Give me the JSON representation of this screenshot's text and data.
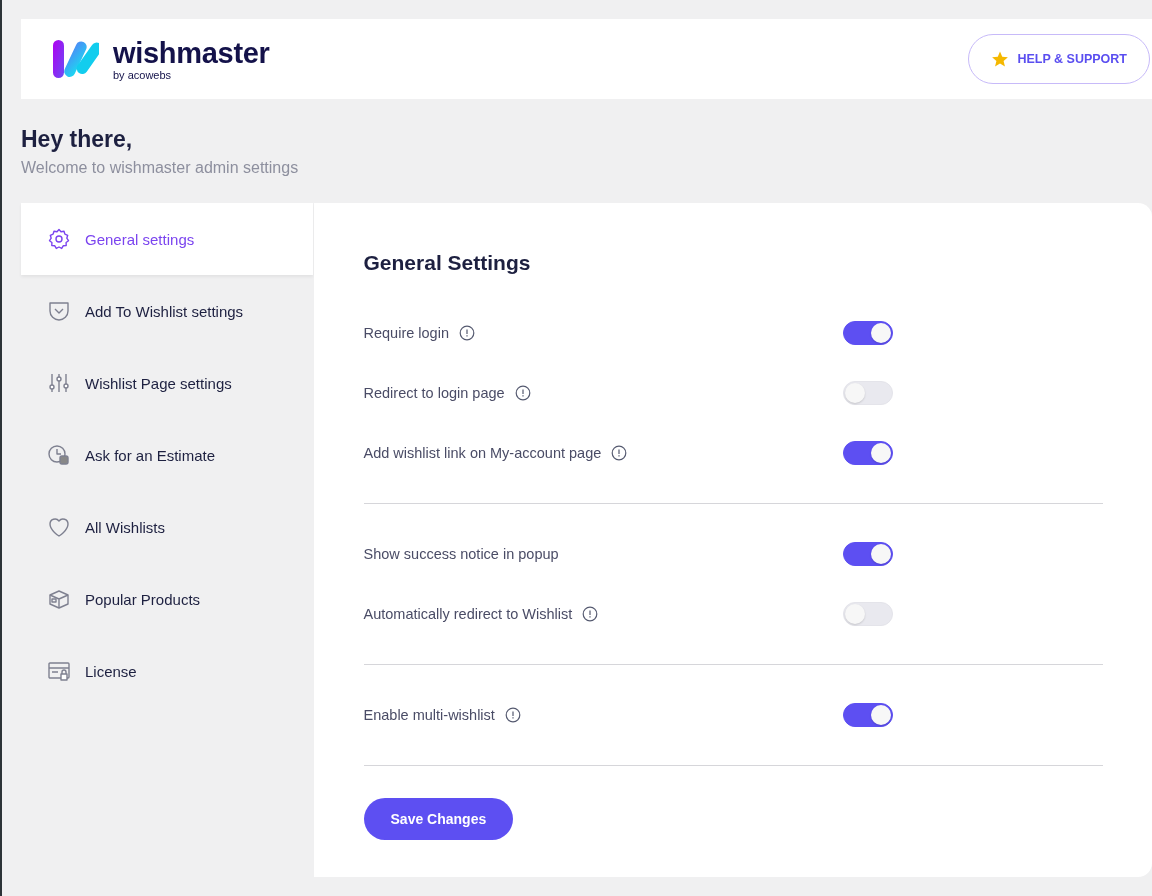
{
  "header": {
    "brand": "wishmaster",
    "byline": "by acowebs",
    "help_button": "HELP & SUPPORT"
  },
  "greeting": {
    "title": "Hey there,",
    "subtitle": "Welcome to wishmaster admin settings"
  },
  "sidebar": {
    "items": [
      {
        "label": "General settings",
        "kind": "gear",
        "selected": true
      },
      {
        "label": "Add To Wishlist settings",
        "kind": "pocket",
        "selected": false
      },
      {
        "label": "Wishlist Page settings",
        "kind": "sliders",
        "selected": false
      },
      {
        "label": "Ask for an Estimate",
        "kind": "estimate",
        "selected": false
      },
      {
        "label": "All Wishlists",
        "kind": "heart",
        "selected": false
      },
      {
        "label": "Popular Products",
        "kind": "box",
        "selected": false
      },
      {
        "label": "License",
        "kind": "license",
        "selected": false
      }
    ]
  },
  "panel": {
    "title": "General Settings",
    "groups": [
      {
        "rows": [
          {
            "label": "Require login",
            "info": true,
            "on": true
          },
          {
            "label": "Redirect to login page",
            "info": true,
            "on": false
          },
          {
            "label": "Add wishlist link on My-account page",
            "info": true,
            "on": true
          }
        ]
      },
      {
        "rows": [
          {
            "label": "Show success notice in popup",
            "info": false,
            "on": true
          },
          {
            "label": "Automatically redirect to Wishlist",
            "info": true,
            "on": false
          }
        ]
      },
      {
        "rows": [
          {
            "label": "Enable multi-wishlist",
            "info": true,
            "on": true
          }
        ]
      }
    ],
    "save_button": "Save Changes"
  }
}
